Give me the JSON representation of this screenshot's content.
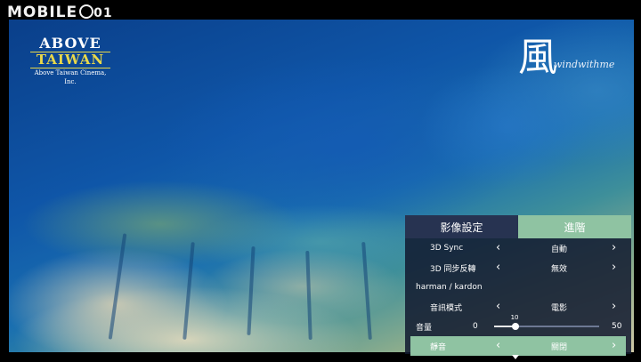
{
  "watermark": {
    "text": "MOBILE",
    "suffix": "01"
  },
  "video": {
    "logo": {
      "line1": "ABOVE",
      "line2": "TAIWAN",
      "line3": "Above Taiwan Cinema, Inc."
    },
    "title_mark": {
      "glyph": "風",
      "subtitle": "windwithme"
    }
  },
  "menu": {
    "tabs": [
      {
        "label": "影像設定"
      },
      {
        "label": "進階"
      }
    ],
    "rows": [
      {
        "label": "3D Sync",
        "value": "自動"
      },
      {
        "label": "3D 同步反轉",
        "value": "無效"
      }
    ],
    "section_label": "harman / kardon",
    "audio_mode": {
      "label": "音訊模式",
      "value": "電影"
    },
    "volume": {
      "label": "音量",
      "min": "0",
      "max": "50",
      "current": "10",
      "fraction": 0.2
    },
    "mute": {
      "label": "靜音",
      "value": "關閉"
    },
    "chevron_left": "‹",
    "chevron_right": "›"
  },
  "colors": {
    "accent": "#8fc3a2",
    "panel": "#121a30"
  }
}
